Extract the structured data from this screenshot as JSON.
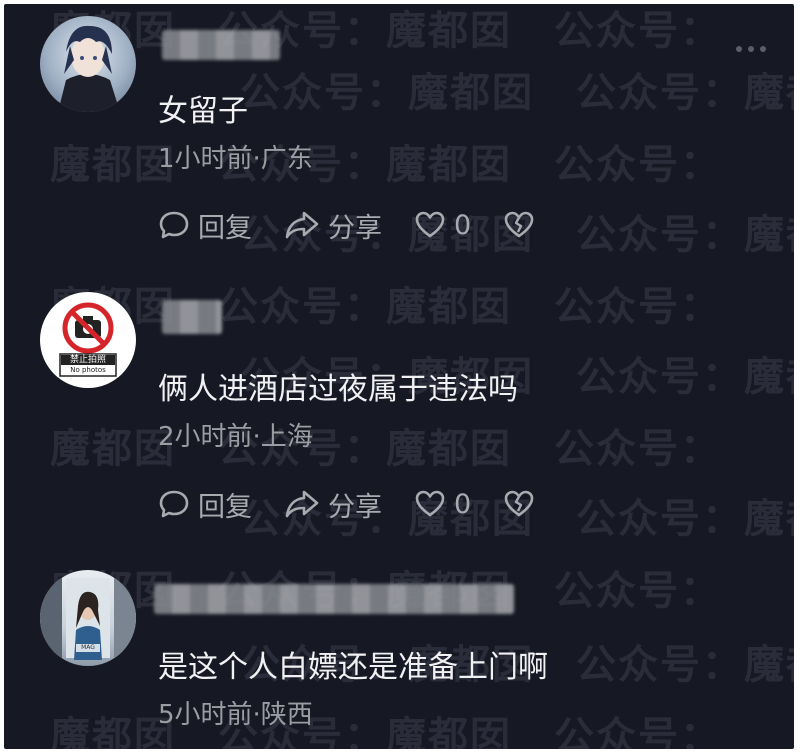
{
  "watermark": {
    "rows": [
      "魔都囡　公众号：魔都囡　公众号：",
      "公众号：魔都囡　公众号：魔都囡",
      "魔都囡　公众号：魔都囡　公众号："
    ]
  },
  "actions": {
    "reply_label": "回复",
    "share_label": "分享",
    "like_count": "0"
  },
  "comments": [
    {
      "content": "女留子",
      "meta": "1小时前·广东",
      "avatar": "anime-character-avatar"
    },
    {
      "content": "俩人进酒店过夜属于违法吗",
      "meta": "2小时前·上海",
      "avatar": "no-photo-sign-avatar",
      "avatar_sign_label": "禁止拍照",
      "avatar_sign_sub": "No photos"
    },
    {
      "content": "是这个人白嫖还是准备上门啊",
      "meta": "5小时前·陕西",
      "avatar": "woman-photo-avatar",
      "avatar_badge": "MAG"
    }
  ],
  "colors": {
    "background": "#161823",
    "text": "#f1f1f3",
    "meta": "#9c9da3"
  }
}
